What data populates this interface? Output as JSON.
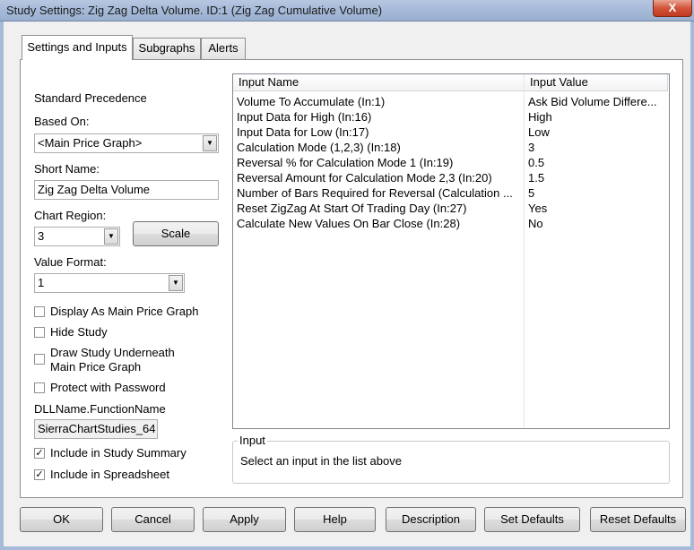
{
  "window": {
    "title": "Study Settings: Zig Zag Delta Volume. ID:1  (Zig Zag Cumulative Volume)",
    "close_label": "X"
  },
  "tabs": [
    {
      "label": "Settings and Inputs",
      "active": true
    },
    {
      "label": "Subgraphs",
      "active": false
    },
    {
      "label": "Alerts",
      "active": false
    }
  ],
  "settings": {
    "standard_precedence": "Standard Precedence",
    "based_on_label": "Based On:",
    "based_on_value": "<Main Price Graph>",
    "short_name_label": "Short Name:",
    "short_name_value": "Zig Zag Delta Volume",
    "chart_region_label": "Chart Region:",
    "chart_region_value": "3",
    "scale_button": "Scale",
    "value_format_label": "Value Format:",
    "value_format_value": "1",
    "checkboxes": [
      {
        "label": "Display As Main Price Graph",
        "checked": false
      },
      {
        "label": "Hide Study",
        "checked": false
      },
      {
        "label": "Draw Study Underneath",
        "label2": "Main Price Graph",
        "checked": false
      },
      {
        "label": "Protect with Password",
        "checked": false
      }
    ],
    "dll_label": "DLLName.FunctionName",
    "dll_value": "SierraChartStudies_64",
    "include_summary": {
      "label": "Include in Study Summary",
      "checked": true
    },
    "include_spreadsheet": {
      "label": "Include in Spreadsheet",
      "checked": true
    },
    "check_mark": "✓"
  },
  "inputs_table": {
    "headers": [
      "Input Name",
      "Input Value"
    ],
    "rows": [
      {
        "name": "Volume To Accumulate  (In:1)",
        "value": "Ask Bid Volume Differe..."
      },
      {
        "name": "Input Data for High  (In:16)",
        "value": "High"
      },
      {
        "name": "Input Data for Low  (In:17)",
        "value": "Low"
      },
      {
        "name": "Calculation Mode (1,2,3)  (In:18)",
        "value": "3"
      },
      {
        "name": "Reversal % for Calculation Mode 1  (In:19)",
        "value": "0.5"
      },
      {
        "name": "Reversal Amount for Calculation Mode 2,3  (In:20)",
        "value": "1.5"
      },
      {
        "name": "Number of Bars Required for Reversal (Calculation ...",
        "value": "5"
      },
      {
        "name": "Reset ZigZag At Start Of Trading Day  (In:27)",
        "value": "Yes"
      },
      {
        "name": "Calculate New Values On Bar Close  (In:28)",
        "value": "No"
      }
    ]
  },
  "input_group": {
    "legend": "Input",
    "description": "Select an input in the list above"
  },
  "buttons": [
    {
      "label": "OK",
      "name": "ok-button"
    },
    {
      "label": "Cancel",
      "name": "cancel-button"
    },
    {
      "label": "Apply",
      "name": "apply-button"
    },
    {
      "label": "Help",
      "name": "help-button"
    },
    {
      "label": "Description",
      "name": "description-button"
    },
    {
      "label": "Set Defaults",
      "name": "set-defaults-button"
    },
    {
      "label": "Reset Defaults",
      "name": "reset-defaults-button"
    }
  ],
  "icons": {
    "dropdown": "▼"
  }
}
